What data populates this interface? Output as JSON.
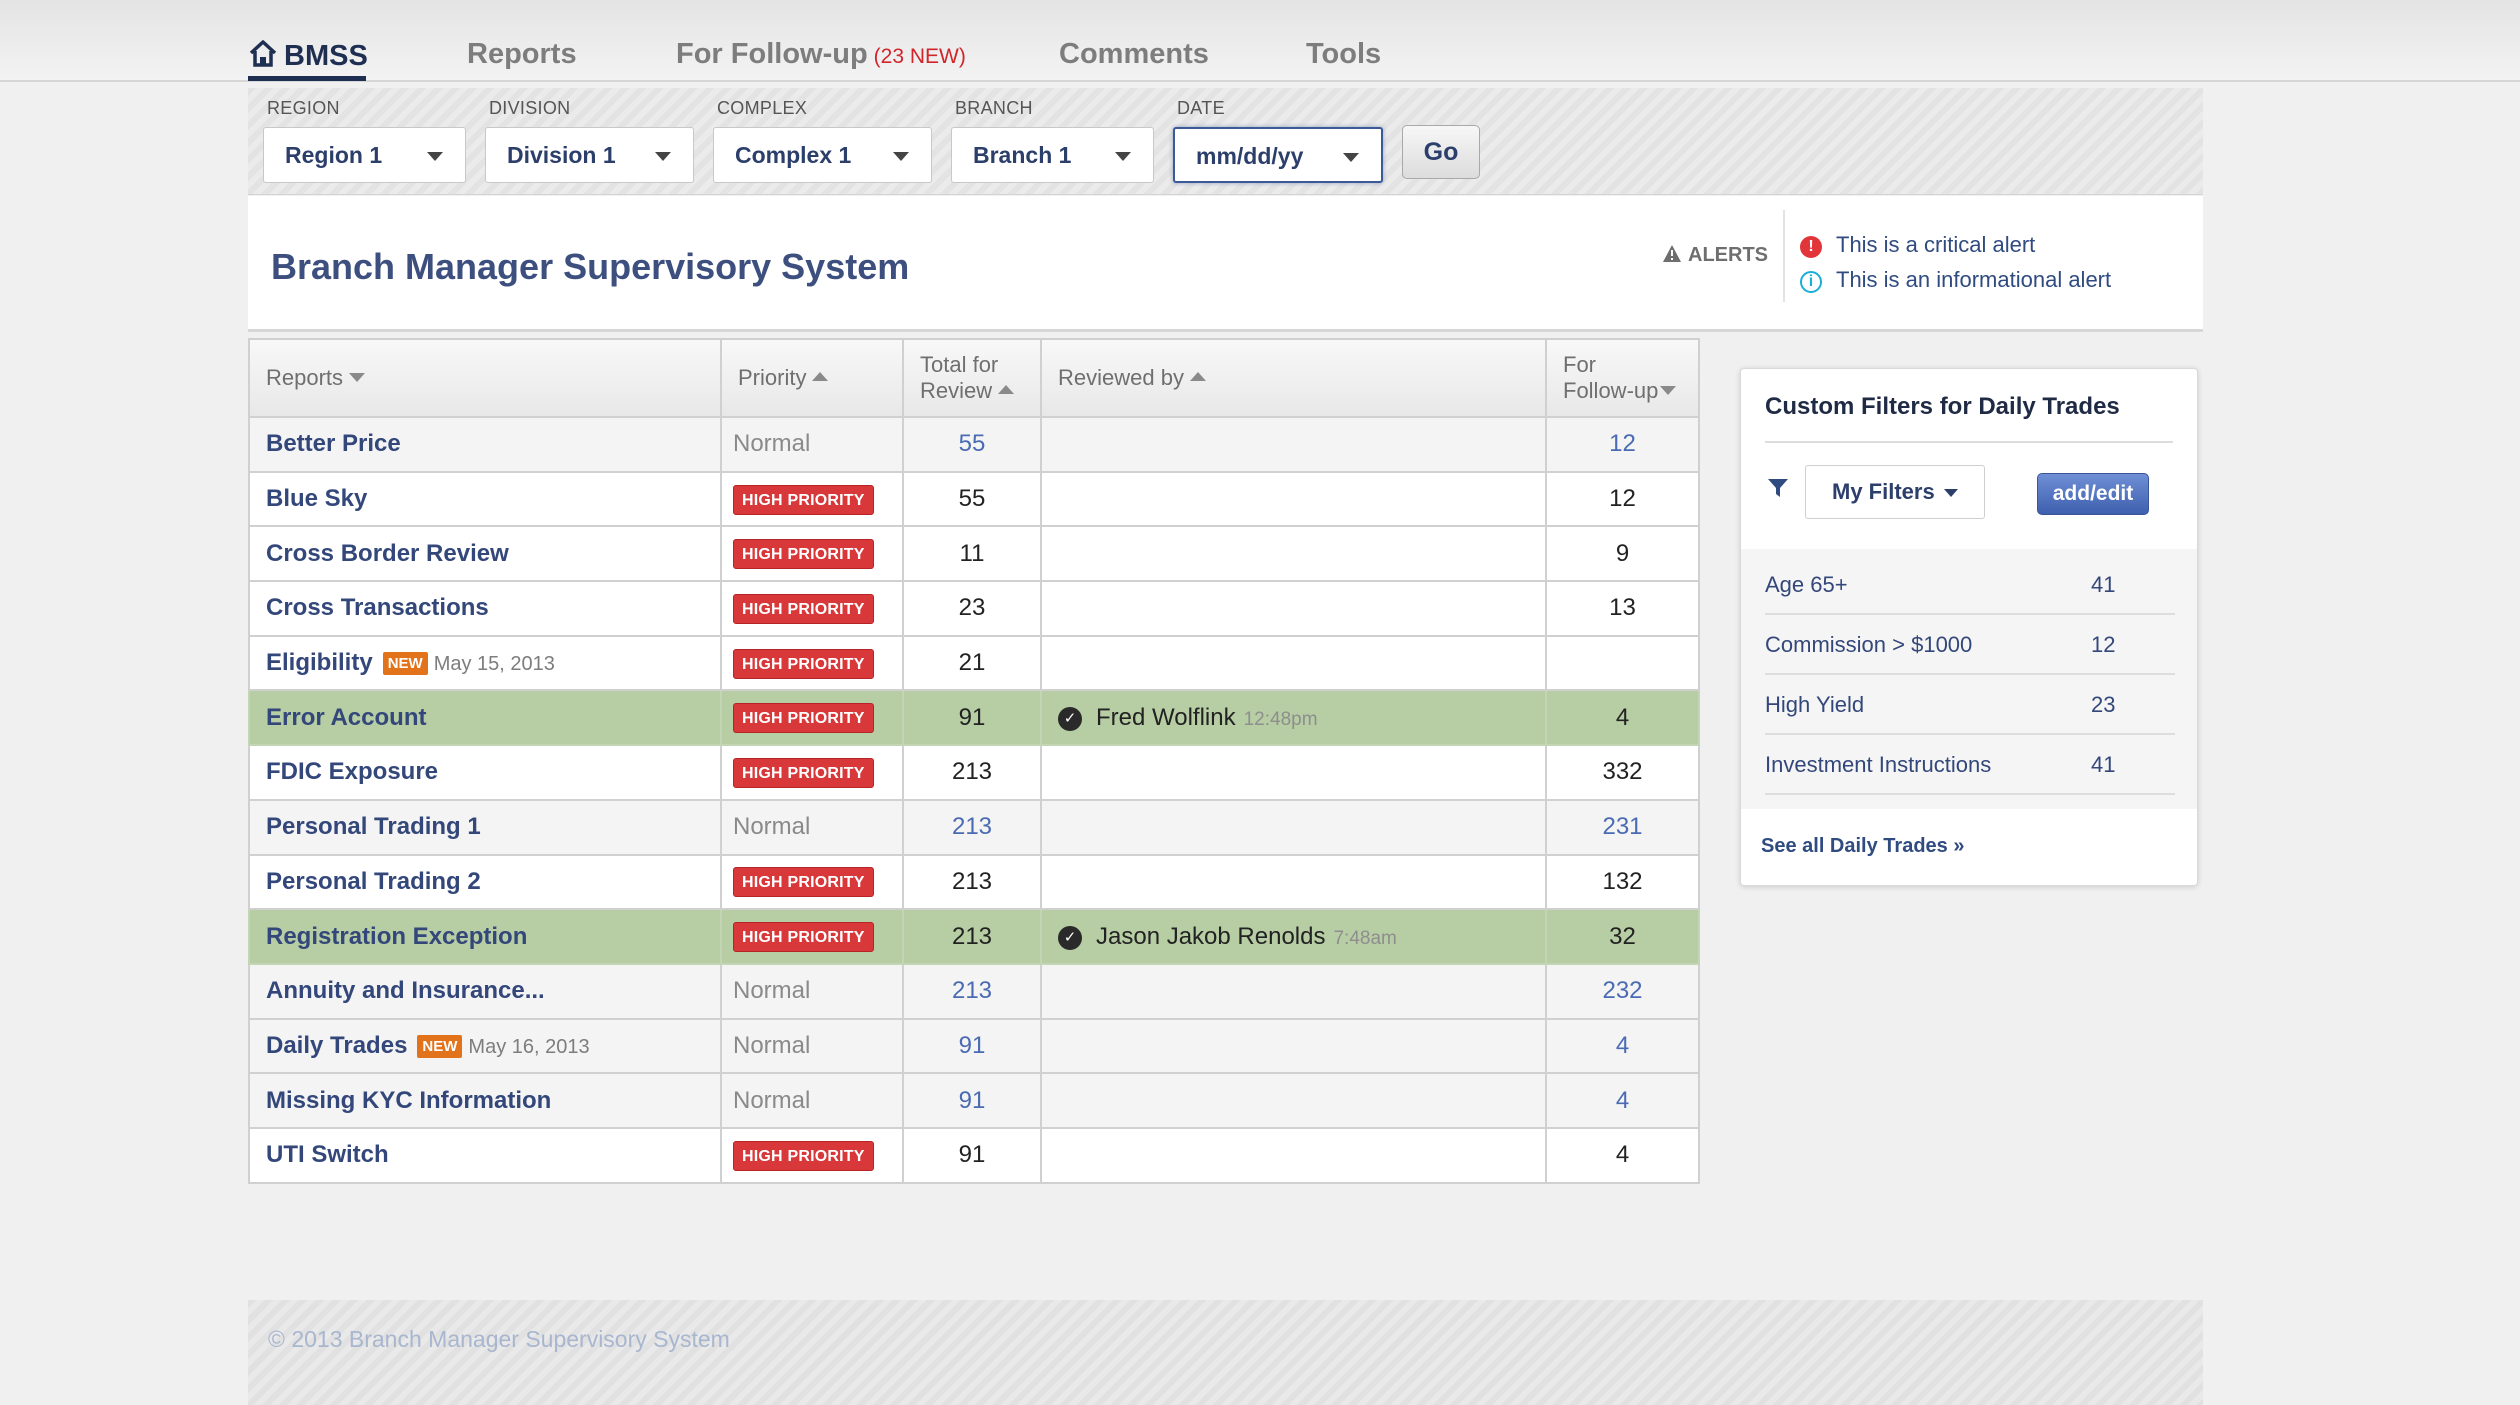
{
  "nav": {
    "brand": "BMSS",
    "reports": "Reports",
    "followup": "For Follow-up",
    "followup_badge": "(23 NEW)",
    "comments": "Comments",
    "tools": "Tools"
  },
  "filters": {
    "region": {
      "label": "REGION",
      "value": "Region 1"
    },
    "division": {
      "label": "DIVISION",
      "value": "Division 1"
    },
    "complex": {
      "label": "COMPLEX",
      "value": "Complex 1"
    },
    "branch": {
      "label": "BRANCH",
      "value": "Branch 1"
    },
    "date": {
      "label": "DATE",
      "value": "mm/dd/yy"
    },
    "go": "Go"
  },
  "header": {
    "title": "Branch Manager Supervisory System",
    "alerts_label": "ALERTS",
    "critical_alert": "This is a critical alert",
    "info_alert": "This is an informational alert"
  },
  "table": {
    "headers": {
      "reports": "Reports",
      "priority": "Priority",
      "total_line1": "Total for",
      "total_line2": "Review",
      "reviewed": "Reviewed by",
      "followup_line1": "For",
      "followup_line2": "Follow-up"
    },
    "rows": [
      {
        "name": "Better Price",
        "priority": "Normal",
        "total": "55",
        "reviewer": "",
        "time": "",
        "followup": "12"
      },
      {
        "name": "Blue Sky",
        "priority": "HIGH PRIORITY",
        "total": "55",
        "reviewer": "",
        "time": "",
        "followup": "12"
      },
      {
        "name": "Cross Border Review",
        "priority": "HIGH PRIORITY",
        "total": "11",
        "reviewer": "",
        "time": "",
        "followup": "9"
      },
      {
        "name": "Cross Transactions",
        "priority": "HIGH PRIORITY",
        "total": "23",
        "reviewer": "",
        "time": "",
        "followup": "13"
      },
      {
        "name": "Eligibility",
        "new": "NEW",
        "date": "May 15, 2013",
        "priority": "HIGH PRIORITY",
        "total": "21",
        "reviewer": "",
        "time": "",
        "followup": ""
      },
      {
        "name": "Error Account",
        "priority": "HIGH PRIORITY",
        "total": "91",
        "reviewer": "Fred Wolflink",
        "time": "12:48pm",
        "followup": "4"
      },
      {
        "name": "FDIC Exposure",
        "priority": "HIGH PRIORITY",
        "total": "213",
        "reviewer": "",
        "time": "",
        "followup": "332"
      },
      {
        "name": "Personal Trading 1",
        "priority": "Normal",
        "total": "213",
        "reviewer": "",
        "time": "",
        "followup": "231"
      },
      {
        "name": "Personal Trading 2",
        "priority": "HIGH PRIORITY",
        "total": "213",
        "reviewer": "",
        "time": "",
        "followup": "132"
      },
      {
        "name": "Registration Exception",
        "priority": "HIGH PRIORITY",
        "total": "213",
        "reviewer": "Jason Jakob Renolds",
        "time": "7:48am",
        "followup": "32"
      },
      {
        "name": "Annuity and Insurance...",
        "priority": "Normal",
        "total": "213",
        "reviewer": "",
        "time": "",
        "followup": "232"
      },
      {
        "name": "Daily Trades",
        "new": "NEW",
        "date": "May 16, 2013",
        "priority": "Normal",
        "total": "91",
        "reviewer": "",
        "time": "",
        "followup": "4"
      },
      {
        "name": "Missing KYC Information",
        "priority": "Normal",
        "total": "91",
        "reviewer": "",
        "time": "",
        "followup": "4"
      },
      {
        "name": "UTI Switch",
        "priority": "HIGH PRIORITY",
        "total": "91",
        "reviewer": "",
        "time": "",
        "followup": "4"
      }
    ]
  },
  "custom_filters": {
    "title": "Custom Filters for Daily Trades",
    "my_filters": "My Filters",
    "add_edit": "add/edit",
    "items": [
      {
        "label": "Age 65+",
        "count": "41"
      },
      {
        "label": "Commission > $1000",
        "count": "12"
      },
      {
        "label": "High Yield",
        "count": "23"
      },
      {
        "label": "Investment Instructions",
        "count": "41"
      }
    ],
    "see_all": "See all Daily Trades »"
  },
  "footer": {
    "text": "© 2013 Branch Manager Supervisory System"
  },
  "colors": {
    "brand_navy": "#1f2f52",
    "link_blue": "#33477a",
    "high_priority_red": "#d9383a",
    "new_orange": "#e3731a",
    "reviewed_green": "#b7cda4",
    "info_cyan": "#1aaed8"
  },
  "icons": {
    "brand": "home-icon",
    "alerts": "warning-triangle-icon",
    "critical": "exclamation-circle-icon",
    "info": "info-circle-icon",
    "reviewed": "checkmark-circle-icon",
    "filter": "funnel-icon"
  }
}
